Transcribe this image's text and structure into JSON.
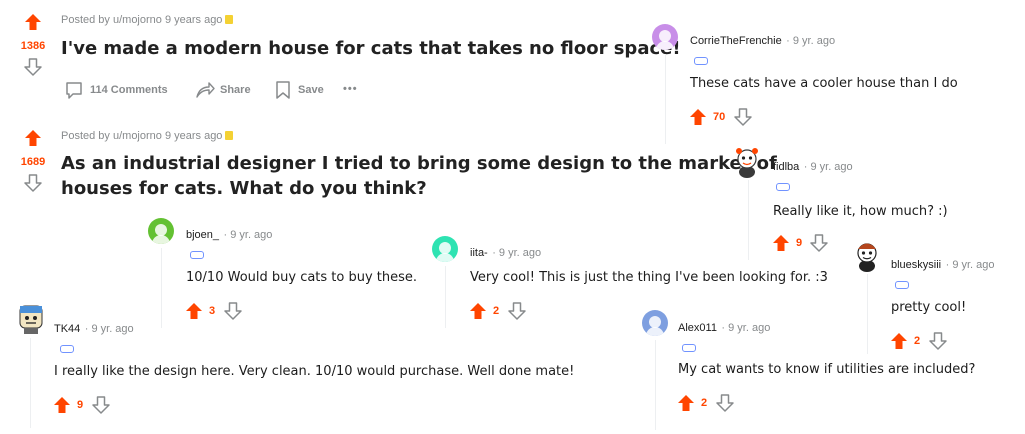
{
  "posts": [
    {
      "score": "1386",
      "meta": "Posted by u/mojorno 9 years ago",
      "title": "I've made a modern house for cats that takes no floor space!",
      "actions": {
        "comments": "114 Comments",
        "share": "Share",
        "save": "Save",
        "more": "•••"
      }
    },
    {
      "score": "1689",
      "meta": "Posted by u/mojorno 9 years ago",
      "title_line1": "As an industrial designer I tried to bring some design to the market of",
      "title_line2": "houses for cats. What do you think?"
    }
  ],
  "comments": {
    "corrie": {
      "user": "CorrieTheFrenchie",
      "age": "· 9 yr. ago",
      "text": "These cats have a cooler house than I do",
      "score": "70",
      "avatar_color": "#c88ee8"
    },
    "fidlba": {
      "user": "fidlba",
      "age": "· 9 yr. ago",
      "text": "Really like it, how much? :)",
      "score": "9"
    },
    "bjoen": {
      "user": "bjoen_",
      "age": "· 9 yr. ago",
      "text": "10/10 Would buy cats to buy these.",
      "score": "3",
      "avatar_color": "#63c132"
    },
    "iita": {
      "user": "iita-",
      "age": "· 9 yr. ago",
      "text": "Very cool! This is just the thing I've been looking for. :3",
      "score": "2",
      "avatar_color": "#2ee3b2"
    },
    "bluesky": {
      "user": "blueskysiii",
      "age": "· 9 yr. ago",
      "text": "pretty cool!",
      "score": "2"
    },
    "tk44": {
      "user": "TK44",
      "age": "· 9 yr. ago",
      "text": "I really like the design here. Very clean. 10/10 would purchase. Well done mate!",
      "score": "9"
    },
    "alex": {
      "user": "Alex011",
      "age": "· 9 yr. ago",
      "text": "My cat wants to know if utilities are included?",
      "score": "2",
      "avatar_color": "#7e9fe0"
    }
  }
}
